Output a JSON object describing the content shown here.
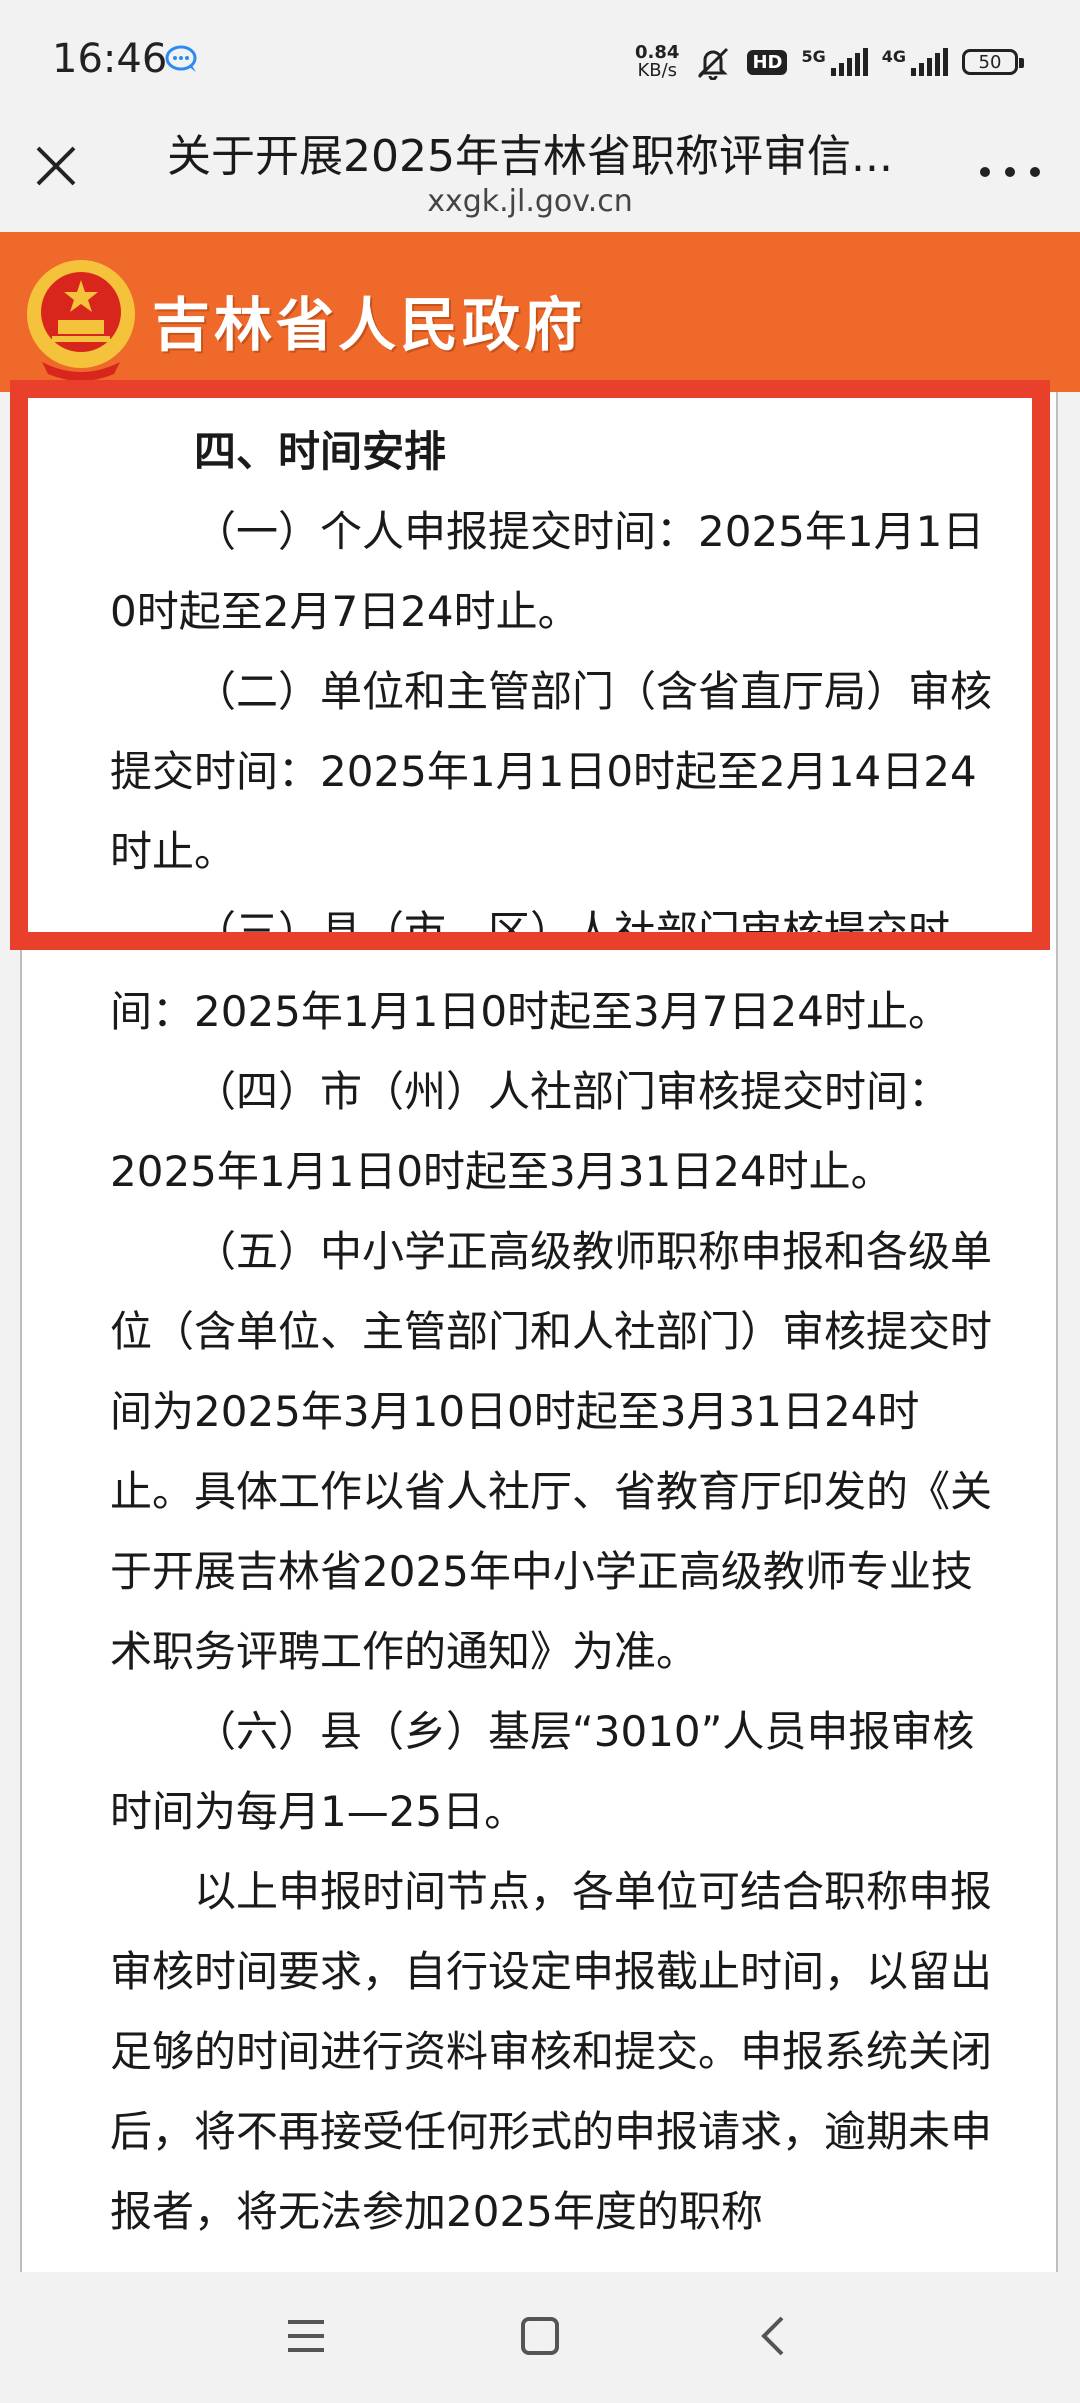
{
  "status": {
    "time": "16:46",
    "net_speed_value": "0.84",
    "net_speed_unit": "KB/s",
    "hd_badge": "HD",
    "signal1_label": "5G",
    "signal2_label": "4G",
    "battery": "50"
  },
  "titlebar": {
    "title": "关于开展2025年吉林省职称评审信...",
    "domain": "xxgk.jl.gov.cn"
  },
  "banner": {
    "title": "吉林省人民政府",
    "color": "#ef6a2a"
  },
  "highlight_color": "#e8402a",
  "article": {
    "heading": "四、时间安排",
    "paragraphs": [
      "（一）个人申报提交时间：2025年1月1日0时起至2月7日24时止。",
      "（二）单位和主管部门（含省直厅局）审核提交时间：2025年1月1日0时起至2月14日24时止。",
      "（三）县（市、区）人社部门审核提交时间：2025年1月1日0时起至3月7日24时止。",
      "（四）市（州）人社部门审核提交时间：2025年1月1日0时起至3月31日24时止。",
      "（五）中小学正高级教师职称申报和各级单位（含单位、主管部门和人社部门）审核提交时间为2025年3月10日0时起至3月31日24时止。具体工作以省人社厅、省教育厅印发的《关于开展吉林省2025年中小学正高级教师专业技术职务评聘工作的通知》为准。",
      "（六）县（乡）基层“3010”人员申报审核时间为每月1—25日。",
      "以上申报时间节点，各单位可结合职称申报审核时间要求，自行设定申报截止时间，以留出足够的时间进行资料审核和提交。申报系统关闭后，将不再接受任何形式的申报请求，逾期未申报者，将无法参加2025年度的职称"
    ]
  }
}
